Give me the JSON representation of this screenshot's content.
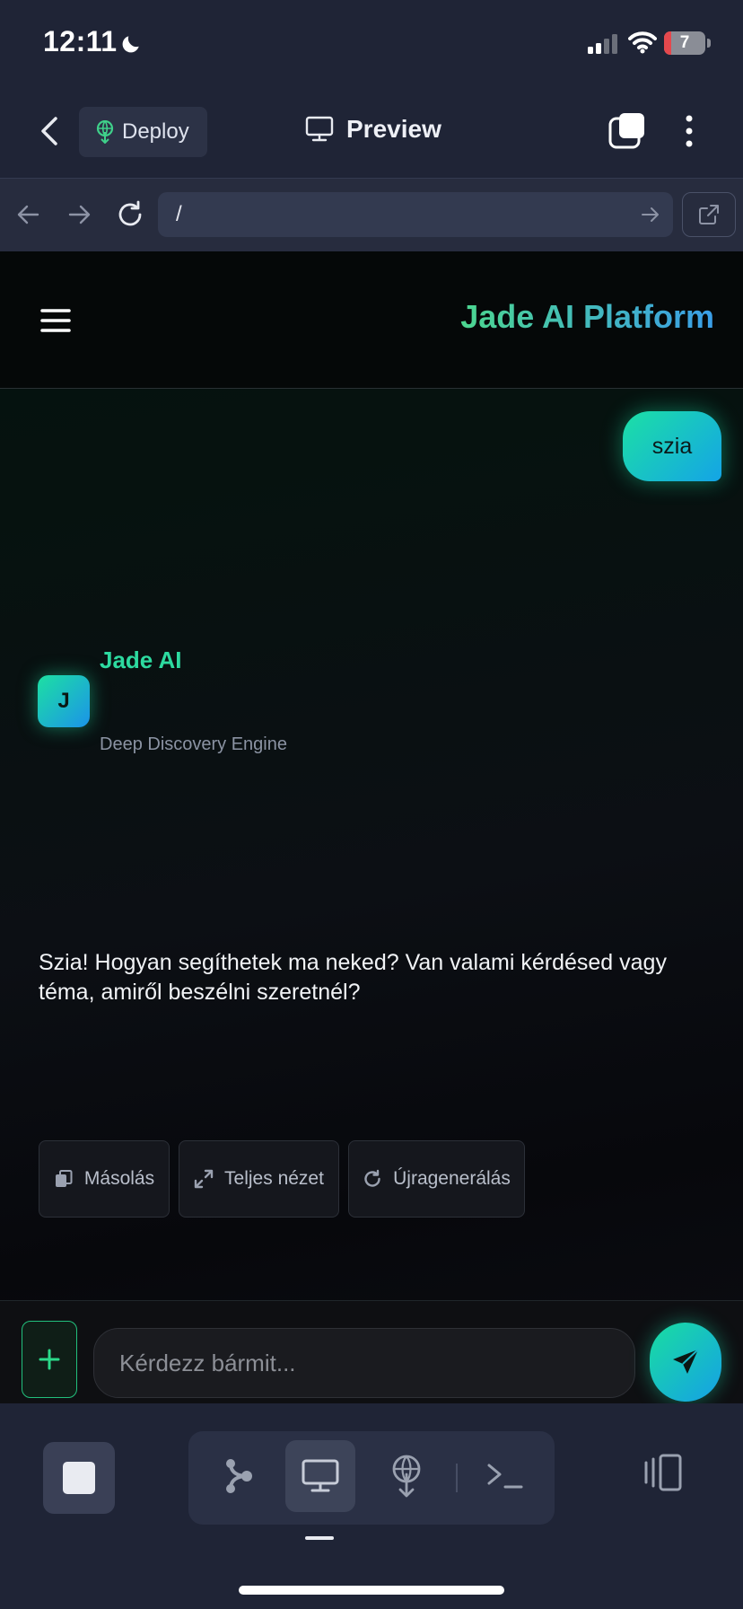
{
  "status_bar": {
    "time": "12:11",
    "battery": "7"
  },
  "header": {
    "deploy_label": "Deploy",
    "preview_label": "Preview"
  },
  "url_bar": {
    "url": "/"
  },
  "app": {
    "title": "Jade AI Platform",
    "user_message": "szia",
    "bot": {
      "avatar_letter": "J",
      "name": "Jade AI",
      "subtitle": "Deep Discovery Engine",
      "message": "Szia! Hogyan segíthetek ma neked? Van valami kérdésed vagy téma, amiről beszélni szeretnél?"
    },
    "actions": {
      "copy": "Másolás",
      "fullscreen": "Teljes nézet",
      "regenerate": "Újragenerálás"
    },
    "input_placeholder": "Kérdezz bármit..."
  },
  "colors": {
    "accent_green": "#2ddaa0",
    "accent_blue": "#15a0e6",
    "chrome_bg": "#1f2436"
  },
  "icons": [
    "moon-icon",
    "signal-icon",
    "wifi-icon",
    "back-icon",
    "deploy-icon",
    "monitor-icon",
    "tabs-icon",
    "more-icon",
    "arrow-left-icon",
    "arrow-right-icon",
    "reload-icon",
    "open-external-icon",
    "hamburger-icon",
    "copy-icon",
    "expand-icon",
    "regenerate-icon",
    "plus-icon",
    "send-icon",
    "flow-icon",
    "terminal-icon",
    "layout-icon"
  ]
}
